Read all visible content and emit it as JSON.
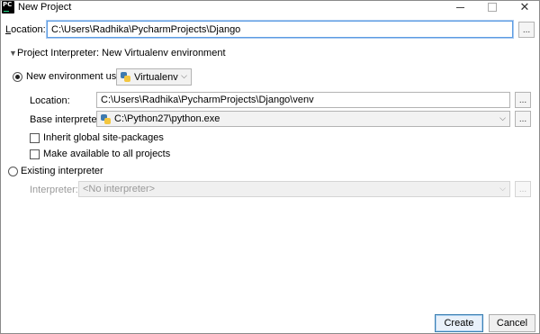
{
  "window": {
    "title": "New Project",
    "app_icon": "PC"
  },
  "project": {
    "location_label_prefix": "L",
    "location_label_rest": "ocation:",
    "location_value": "C:\\Users\\Radhika\\PycharmProjects\\Django",
    "browse_label": "..."
  },
  "interpreter_section": {
    "header": "Project Interpreter: New Virtualenv environment",
    "expander_icon": "triangle-down-icon",
    "new_env": {
      "label": "New environment using",
      "selected": true,
      "tool": "Virtualenv",
      "location_label": "Location:",
      "location_value": "C:\\Users\\Radhika\\PycharmProjects\\Django\\venv",
      "base_label": "Base interpreter:",
      "base_value": "C:\\Python27\\python.exe",
      "inherit_label": "Inherit global site-packages",
      "inherit_checked": false,
      "available_label": "Make available to all projects",
      "available_checked": false
    },
    "existing": {
      "label": "Existing interpreter",
      "selected": false,
      "interpreter_label": "Interpreter:",
      "interpreter_value": "<No interpreter>"
    }
  },
  "buttons": {
    "create": "Create",
    "cancel": "Cancel"
  },
  "colors": {
    "accent": "#5c9ce3",
    "focus_ring": "#a9c9f0",
    "primary_button_border": "#3c7fb1"
  }
}
